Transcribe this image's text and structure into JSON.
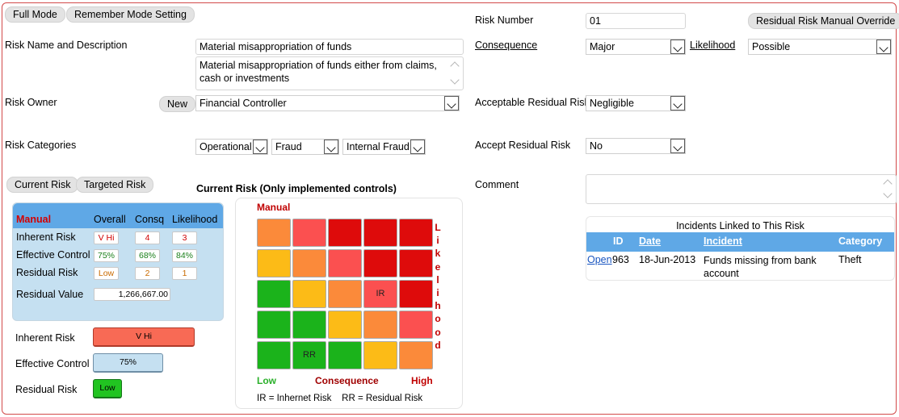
{
  "toolbar": {
    "full_mode": "Full Mode",
    "remember_mode": "Remember Mode Setting",
    "residual_override": "Residual Risk Manual Override"
  },
  "risk": {
    "number_label": "Risk Number",
    "number_value": "01",
    "name_label": "Risk Name and Description",
    "name_value": "Material misappropriation of funds",
    "description_value": "Material misappropriation of funds either from claims, cash or investments",
    "consequence_label": "Consequence",
    "consequence_value": "Major",
    "likelihood_label": "Likelihood",
    "likelihood_value": "Possible",
    "owner_label": "Risk Owner",
    "owner_new_button": "New",
    "owner_value": "Financial Controller",
    "acceptable_residual_label": "Acceptable Residual Risk",
    "acceptable_residual_value": "Negligible",
    "categories_label": "Risk Categories",
    "category_1": "Operational",
    "category_2": "Fraud",
    "category_3": "Internal Fraud",
    "accept_residual_label": "Accept Residual Risk",
    "accept_residual_value": "No",
    "comment_label": "Comment",
    "comment_value": ""
  },
  "tabs": {
    "current": "Current Risk",
    "targeted": "Targeted Risk"
  },
  "summary": {
    "title": "Current Risk (Only implemented controls)",
    "header_manual": "Manual",
    "header_overall": "Overall",
    "header_consq": "Consq",
    "header_likelihood": "Likelihood",
    "rows": [
      {
        "label": "Inherent Risk",
        "overall": "V Hi",
        "consq": "4",
        "likelihood": "3"
      },
      {
        "label": "Effective Control",
        "overall": "75%",
        "consq": "68%",
        "likelihood": "84%"
      },
      {
        "label": "Residual Risk",
        "overall": "Low",
        "consq": "2",
        "likelihood": "1"
      }
    ],
    "residual_value_label": "Residual Value",
    "residual_value": "1,266,667.00",
    "bars": [
      {
        "label": "Inherent Risk",
        "value": "V Hi"
      },
      {
        "label": "Effective Control",
        "value": "75%"
      },
      {
        "label": "Residual Risk",
        "value": "Low"
      }
    ]
  },
  "heatmap": {
    "manual_label": "Manual",
    "likelihood_axis": "Likelihood",
    "low_label": "Low",
    "consequence_label": "Consequence",
    "high_label": "High",
    "legend": "IR = Inhernet Risk    RR = Residual Risk",
    "colors": {
      "red": "#de0b0b",
      "light_red": "#fb5050",
      "orange": "#fb8a3a",
      "yellow": "#fcbb17",
      "green": "#1bb31b"
    },
    "grid": [
      [
        "orange",
        "light_red",
        "red",
        "red",
        "red"
      ],
      [
        "yellow",
        "orange",
        "light_red",
        "red",
        "red"
      ],
      [
        "green",
        "yellow",
        "orange",
        "light_red",
        "red"
      ],
      [
        "green",
        "green",
        "yellow",
        "orange",
        "light_red"
      ],
      [
        "green",
        "green",
        "green",
        "yellow",
        "orange"
      ]
    ],
    "ir_label": "IR",
    "rr_label": "RR"
  },
  "incidents": {
    "title": "Incidents Linked to This Risk",
    "headers": {
      "id": "ID",
      "date": "Date",
      "incident": "Incident",
      "category": "Category"
    },
    "rows": [
      {
        "open": "Open",
        "id": "963",
        "date": "18-Jun-2013",
        "incident": "Funds missing from bank account",
        "category": "Theft"
      }
    ]
  }
}
